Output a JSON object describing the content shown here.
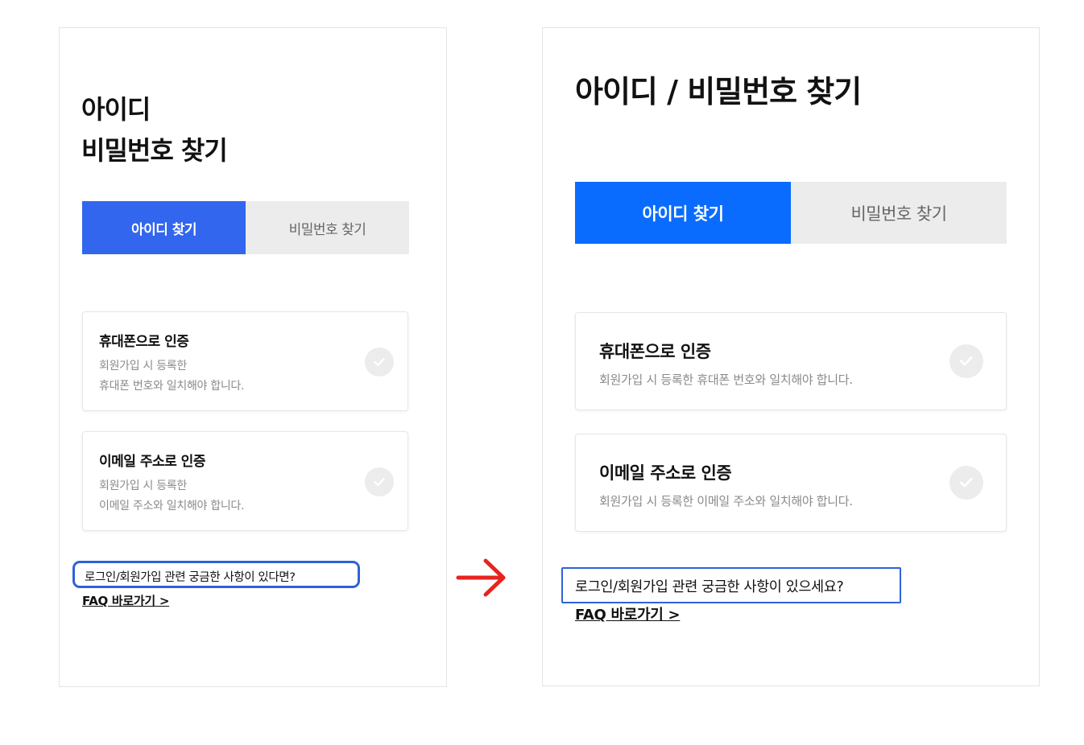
{
  "colors": {
    "accent_left": "#3366ee",
    "accent_right": "#0a6cff",
    "highlight": "#2e62d9",
    "arrow": "#e8231f"
  },
  "before": {
    "title_lines": [
      "아이디",
      "비밀번호 찾기"
    ],
    "tabs": [
      {
        "label": "아이디 찾기",
        "active": true
      },
      {
        "label": "비밀번호 찾기",
        "active": false
      }
    ],
    "cards": [
      {
        "title": "휴대폰으로 인증",
        "desc_lines": [
          "회원가입 시 등록한",
          "휴대폰 번호와 일치해야 합니다."
        ],
        "icon": "check-circle-icon"
      },
      {
        "title": "이메일 주소로 인증",
        "desc_lines": [
          "회원가입 시 등록한",
          "이메일 주소와 일치해야 합니다."
        ],
        "icon": "check-circle-icon"
      }
    ],
    "faq_question": "로그인/회원가입 관련 궁금한 사항이 있다면?",
    "faq_link": "FAQ 바로가기 >"
  },
  "after": {
    "title": "아이디 / 비밀번호 찾기",
    "tabs": [
      {
        "label": "아이디 찾기",
        "active": true
      },
      {
        "label": "비밀번호 찾기",
        "active": false
      }
    ],
    "cards": [
      {
        "title": "휴대폰으로 인증",
        "desc": "회원가입 시 등록한 휴대폰 번호와 일치해야 합니다.",
        "icon": "check-circle-icon"
      },
      {
        "title": "이메일 주소로 인증",
        "desc": "회원가입 시 등록한 이메일 주소와 일치해야 합니다.",
        "icon": "check-circle-icon"
      }
    ],
    "faq_question": "로그인/회원가입 관련 궁금한 사항이 있으세요?",
    "faq_link": "FAQ 바로가기 >"
  },
  "transition_icon": "right-arrow-icon"
}
